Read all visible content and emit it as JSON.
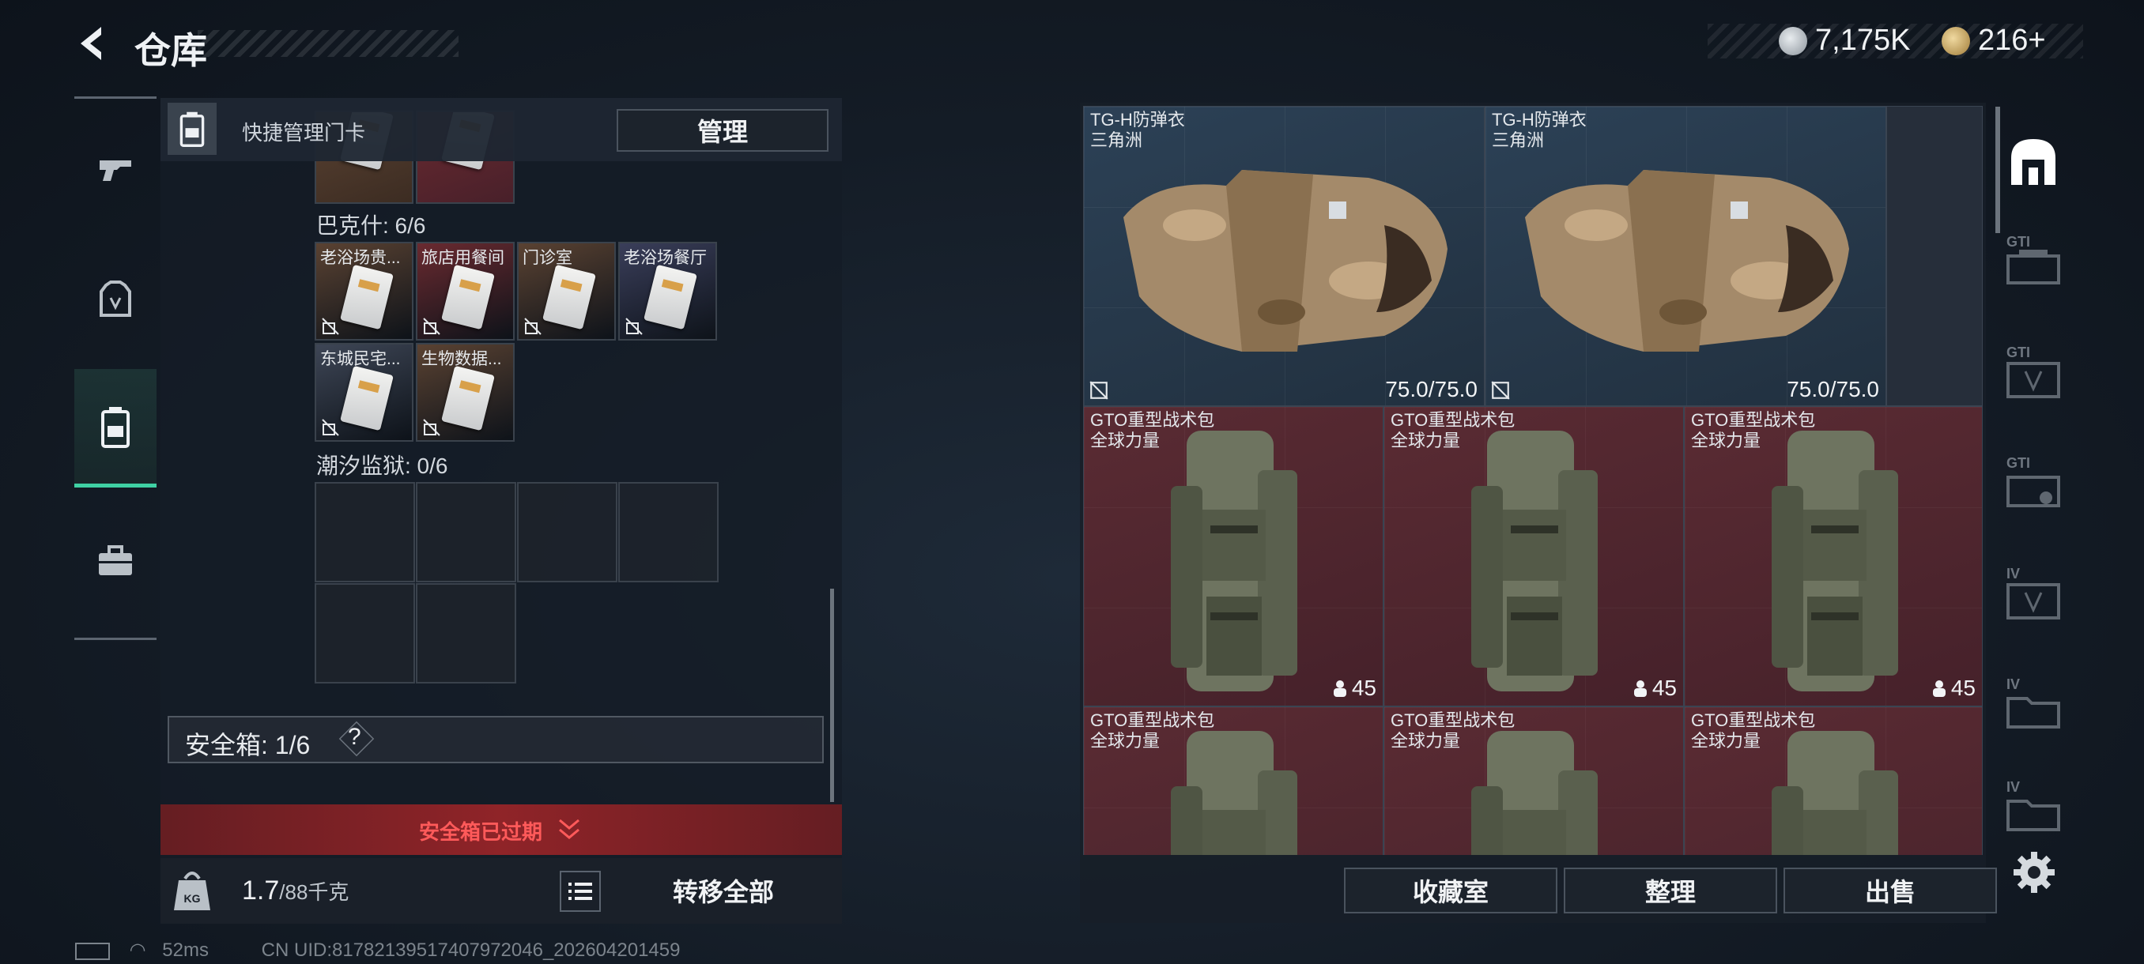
{
  "header": {
    "title": "仓库",
    "currency_silver": "7,175K",
    "currency_gold": "216+"
  },
  "quick_manage": {
    "label": "快捷管理门卡",
    "manage_button": "管理"
  },
  "sections": [
    {
      "label": "巴克什: 6/6",
      "cards": [
        {
          "name": "老浴场贵...",
          "color": "#5a4232"
        },
        {
          "name": "旅店用餐间",
          "color": "#6a2a30"
        },
        {
          "name": "门诊室",
          "color": "#5a4232"
        },
        {
          "name": "老浴场餐厅",
          "color": "#3a3e5a"
        },
        {
          "name": "东城民宅...",
          "color": "#3e4656"
        },
        {
          "name": "生物数据...",
          "color": "#5a4232"
        }
      ]
    },
    {
      "label": "潮汐监狱: 0/6"
    }
  ],
  "safe_box": {
    "label": "安全箱: 1/6",
    "help_glyph": "?",
    "expired_label": "安全箱已过期"
  },
  "bottom": {
    "weight_value": "1.7",
    "weight_capacity": "/88千克",
    "transfer_all": "转移全部"
  },
  "items": [
    {
      "name": "TG-H防弹衣",
      "sub": "三角洲",
      "value": "75.0/75.0",
      "type": "armor"
    },
    {
      "name": "TG-H防弹衣",
      "sub": "三角洲",
      "value": "75.0/75.0",
      "type": "armor"
    },
    {
      "name": "GTO重型战术包",
      "sub": "全球力量",
      "value": "45",
      "type": "backpack"
    },
    {
      "name": "GTO重型战术包",
      "sub": "全球力量",
      "value": "45",
      "type": "backpack"
    },
    {
      "name": "GTO重型战术包",
      "sub": "全球力量",
      "value": "45",
      "type": "backpack"
    },
    {
      "name": "GTO重型战术包",
      "sub": "全球力量",
      "value": "",
      "type": "backpack"
    },
    {
      "name": "GTO重型战术包",
      "sub": "全球力量",
      "value": "",
      "type": "backpack"
    },
    {
      "name": "GTO重型战术包",
      "sub": "全球力量",
      "value": "",
      "type": "backpack"
    }
  ],
  "right_buttons": {
    "collection": "收藏室",
    "organize": "整理",
    "sell": "出售"
  },
  "right_side_tabs": [
    "GTI",
    "GTI",
    "GTI",
    "IV",
    "IV",
    "IV"
  ],
  "status": {
    "ping": "52ms",
    "uid": "CN UID:8178213951740797204​6_202604201459"
  },
  "colors": {
    "accent": "#3fd1a4",
    "expired_red": "#ff5a5a",
    "armor_cell": "#2c4156",
    "backpack_cell": "#5a2b33"
  }
}
